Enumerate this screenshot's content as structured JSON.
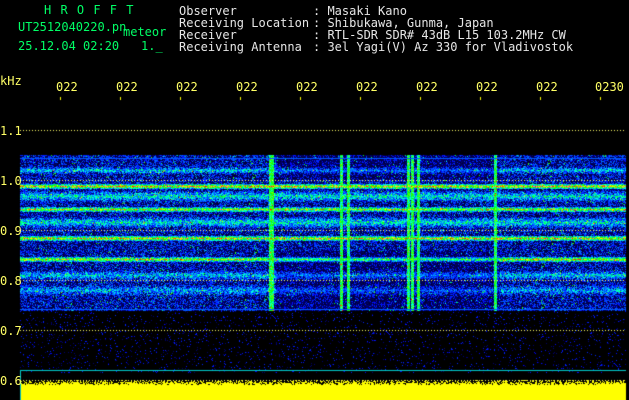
{
  "header": {
    "program": "H R O F F T",
    "file": "UT2512040220.pn",
    "meteor_label": "meteor",
    "datetime": "25.12.04 02:20",
    "frame_indicator": "1._",
    "info_labels": [
      "Observer",
      "Receiving Location",
      "Receiver",
      "Receiving Antenna"
    ],
    "info_values": [
      ": Masaki Kano",
      ": Shibukawa, Gunma, Japan",
      ": RTL-SDR SDR# 43dB L15 103.2MHz CW",
      ": 3el Yagi(V) Az 330 for Vladivostok"
    ]
  },
  "axis": {
    "unit": "kHz",
    "y_ticks": [
      "1.1",
      "1.0",
      "0.9",
      "0.8",
      "0.7",
      "0.6"
    ],
    "x_ticks": [
      "022",
      "022",
      "022",
      "022",
      "022",
      "022",
      "022",
      "022",
      "022",
      "0230"
    ]
  },
  "colors": {
    "header_green": "#00ff66",
    "text_white": "#e6e6e6",
    "axis_yellow": "#ffff66"
  }
}
